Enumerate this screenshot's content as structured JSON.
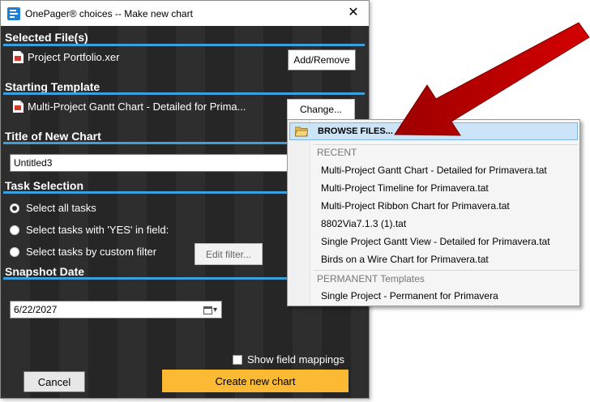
{
  "window": {
    "title": "OnePager® choices -- Make new chart",
    "close_glyph": "✕"
  },
  "sections": {
    "selected_files": "Selected File(s)",
    "starting_template": "Starting Template",
    "title_of_new_chart": "Title of New Chart",
    "task_selection": "Task Selection",
    "snapshot_date": "Snapshot Date"
  },
  "selected_file": {
    "name": "Project Portfolio.xer",
    "icon": "file-document-icon"
  },
  "add_remove_label": "Add/Remove",
  "template": {
    "name": "Multi-Project Gantt Chart - Detailed for Prima...",
    "icon": "file-document-icon"
  },
  "change_label": "Change...",
  "chart_title_value": "Untitled3",
  "task_options": [
    {
      "label": "Select all tasks",
      "selected": true
    },
    {
      "label": "Select tasks with 'YES' in field:",
      "selected": false
    },
    {
      "label": "Select tasks by custom filter",
      "selected": false
    }
  ],
  "edit_filter_label": "Edit filter...",
  "snapshot_date_value": "6/22/2027",
  "show_field_mappings_label": "Show field mappings",
  "cancel_label": "Cancel",
  "create_label": "Create new chart",
  "menu": {
    "browse_label": "BROWSE FILES...",
    "recent_header": "RECENT",
    "recent_items": [
      "Multi-Project Gantt Chart - Detailed for Primavera.tat",
      "Multi-Project Timeline for Primavera.tat",
      "Multi-Project Ribbon Chart for Primavera.tat",
      "8802Via7.1.3 (1).tat",
      "Single Project Gantt View - Detailed for Primavera.tat",
      "Birds on a Wire Chart for Primavera.tat"
    ],
    "permanent_header": "PERMANENT Templates",
    "permanent_items": [
      "Single Project - Permanent for Primavera"
    ]
  },
  "colors": {
    "accent_line": "#3aa1de",
    "create_button": "#fbb934",
    "arrow": "#c00000",
    "menu_highlight": "#cce4f7"
  }
}
